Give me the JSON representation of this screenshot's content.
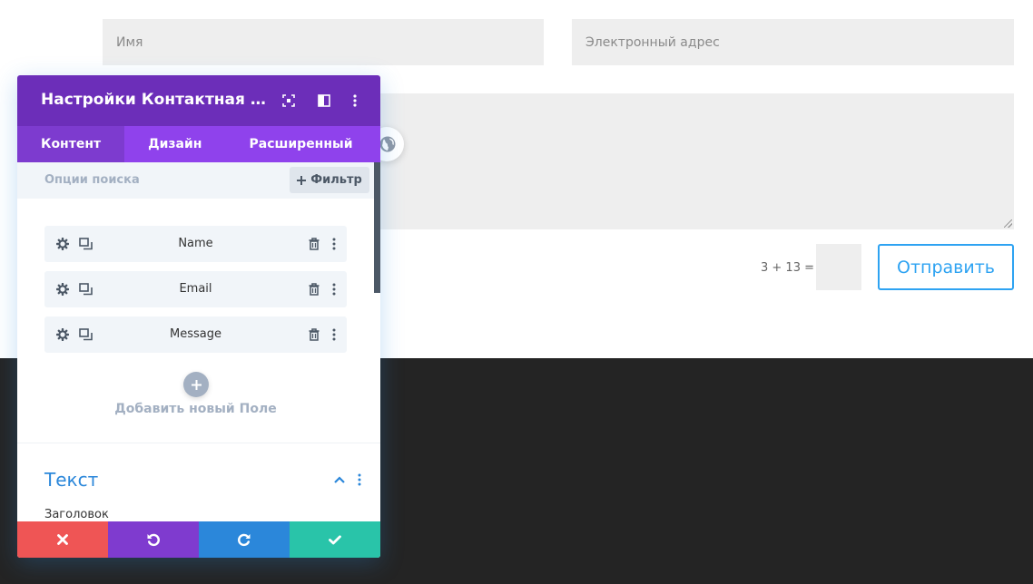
{
  "form": {
    "name_placeholder": "Имя",
    "email_placeholder": "Электронный адрес",
    "captcha_question": "3 + 13 =",
    "submit_label": "Отправить"
  },
  "panel": {
    "title": "Настройки Контактная ф...",
    "tabs": [
      {
        "label": "Контент",
        "active": true
      },
      {
        "label": "Дизайн",
        "active": false
      },
      {
        "label": "Расширенный",
        "active": false
      }
    ],
    "search_placeholder": "Опции поиска",
    "filter_label": "Фильтр",
    "fields": [
      {
        "label": "Name"
      },
      {
        "label": "Email"
      },
      {
        "label": "Message"
      }
    ],
    "add_field_label": "Добавить новый Поле",
    "section": {
      "title": "Текст",
      "subfield_label": "Заголовок"
    }
  },
  "colors": {
    "header": "#6c2eb9",
    "tabs": "#8f42ec",
    "accent_blue": "#2b87da",
    "submit_blue": "#2ea3f2",
    "cancel": "#ef5555",
    "undo": "#7f3bcf",
    "redo": "#2b87da",
    "save": "#29c4a9",
    "dark_section": "#242424"
  },
  "icons": {
    "header": [
      "expand-icon",
      "split-view-icon",
      "more-vertical-icon"
    ],
    "row": [
      "gear-icon",
      "duplicate-icon",
      "trash-icon",
      "more-vertical-icon"
    ],
    "footer": [
      "close-icon",
      "undo-icon",
      "redo-icon",
      "check-icon"
    ],
    "misc": [
      "globe-icon",
      "plus-icon",
      "chevron-up-icon"
    ]
  }
}
